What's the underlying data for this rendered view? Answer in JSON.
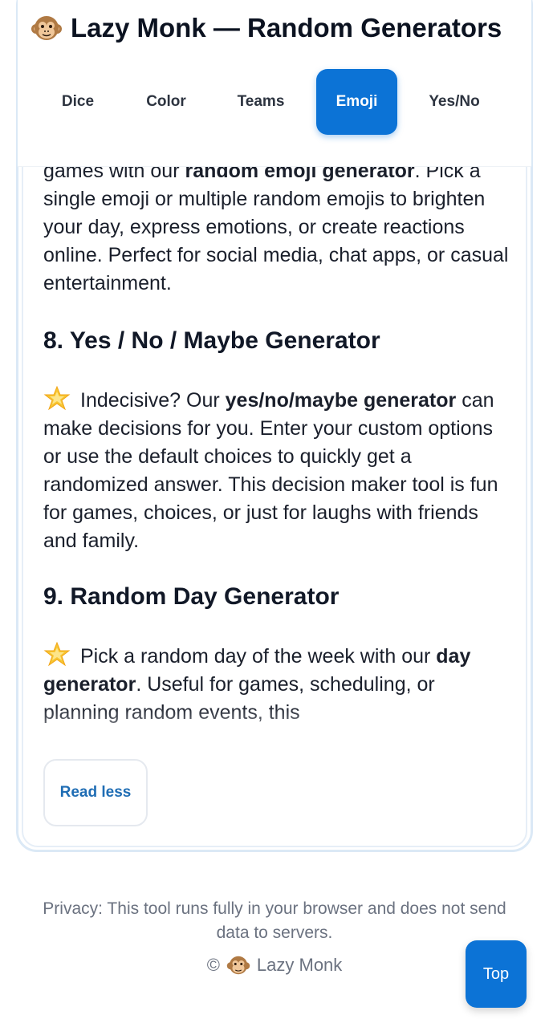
{
  "header": {
    "title": "Lazy Monk — Random Generators",
    "logo_icon": "monkey-face-icon"
  },
  "tabs": [
    {
      "label": "Dice",
      "active": false
    },
    {
      "label": "Color",
      "active": false
    },
    {
      "label": "Teams",
      "active": false
    },
    {
      "label": "Emoji",
      "active": true
    },
    {
      "label": "Yes/No",
      "active": false
    }
  ],
  "content": {
    "emoji_section": {
      "line1_prefix": "games with our ",
      "line1_bold": "random emoji generator",
      "line1_suffix": ".",
      "rest": "Pick a single emoji or multiple random emojis to brighten your day, express emotions, or create reactions online. Perfect for social media, chat apps, or casual entertainment."
    },
    "yesno_section": {
      "heading": "8. Yes / No / Maybe Generator",
      "icon": "star-icon",
      "prefix": "Indecisive? Our ",
      "bold": "yes/no/maybe generator",
      "suffix": " can make decisions for you. Enter your custom options or use the default choices to quickly get a randomized answer. This decision maker tool is fun for games, choices, or just for laughs with friends and family."
    },
    "day_section": {
      "heading": "9. Random Day Generator",
      "icon": "star-icon",
      "prefix": "Pick a random day of the week with our ",
      "bold": "day generator",
      "suffix": ". Useful for games, scheduling, or planning random events, this"
    }
  },
  "read_less_label": "Read less",
  "footer": {
    "privacy": "Privacy: This tool runs fully in your browser and does not send data to servers.",
    "copyright_symbol": "©",
    "brand": "Lazy Monk"
  },
  "top_button_label": "Top",
  "colors": {
    "accent": "#0c73d6",
    "link": "#1f6db4",
    "muted": "#6b7280"
  }
}
